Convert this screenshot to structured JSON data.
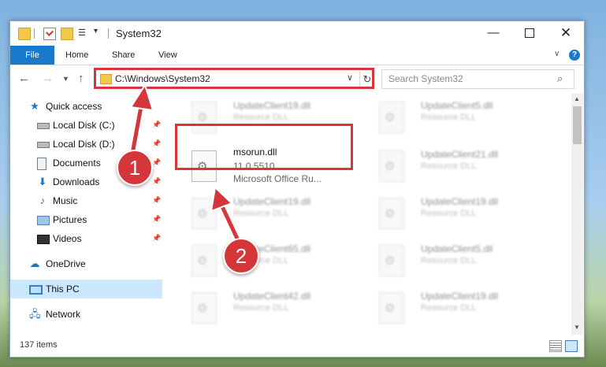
{
  "window": {
    "title": "System32",
    "controls": {
      "minimize": "—",
      "maximize": "",
      "close": "✕"
    }
  },
  "ribbon": {
    "tabs": [
      "File",
      "Home",
      "Share",
      "View"
    ]
  },
  "address": {
    "path": "C:\\Windows\\System32",
    "search_placeholder": "Search System32"
  },
  "sidebar": {
    "items": [
      {
        "label": "Quick access",
        "icon": "star-icon"
      },
      {
        "label": "Local Disk (C:)",
        "icon": "drive-icon",
        "pinned": true
      },
      {
        "label": "Local Disk (D:)",
        "icon": "drive-icon",
        "pinned": true
      },
      {
        "label": "Documents",
        "icon": "document-icon",
        "pinned": true
      },
      {
        "label": "Downloads",
        "icon": "download-icon",
        "pinned": true
      },
      {
        "label": "Music",
        "icon": "music-icon",
        "pinned": true
      },
      {
        "label": "Pictures",
        "icon": "picture-icon",
        "pinned": true
      },
      {
        "label": "Videos",
        "icon": "video-icon",
        "pinned": true
      },
      {
        "label": "OneDrive",
        "icon": "cloud-icon"
      },
      {
        "label": "This PC",
        "icon": "computer-icon",
        "selected": true
      },
      {
        "label": "Network",
        "icon": "network-icon"
      }
    ]
  },
  "files": {
    "highlighted": {
      "name": "msorun.dll",
      "version": "11.0.5510",
      "description": "Microsoft Office Ru..."
    },
    "left_column": [
      {
        "name": "UpdateClient19.dll",
        "type": "Resource DLL"
      },
      {
        "name": "UpdateClient19.dll",
        "type": "Resource DLL"
      },
      {
        "name": "UpdateClient65.dll",
        "type": "Resource DLL"
      },
      {
        "name": "UpdateClient42.dll",
        "type": "Resource DLL"
      }
    ],
    "right_column": [
      {
        "name": "UpdateClient5.dll",
        "type": "Resource DLL"
      },
      {
        "name": "UpdateClient21.dll",
        "type": "Resource DLL"
      },
      {
        "name": "UpdateClient19.dll",
        "type": "Resource DLL"
      },
      {
        "name": "UpdateClient5.dll",
        "type": "Resource DLL"
      },
      {
        "name": "UpdateClient19.dll",
        "type": "Resource DLL"
      }
    ]
  },
  "status": {
    "item_count": "137 items"
  },
  "annotations": {
    "marker1": "1",
    "marker2": "2",
    "color": "#d4363a"
  }
}
